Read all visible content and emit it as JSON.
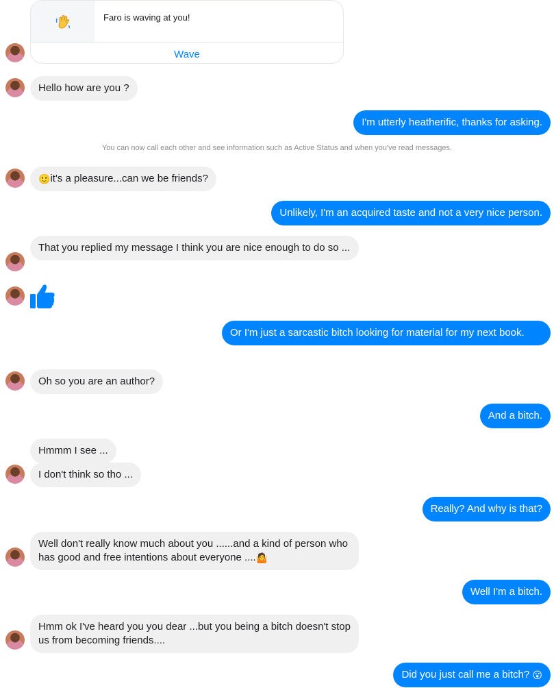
{
  "wave_card": {
    "text": "Faro is waving at you!",
    "button": "Wave",
    "icon": "waving-hand-icon"
  },
  "system_notice": "You can now call each other and see information such as Active Status and when you've read messages.",
  "messages": {
    "m1": "Hello how are you ?",
    "m2": "I'm utterly heatherific, thanks for asking.",
    "m3": "it's a pleasure...can we be friends?",
    "m4": "Unlikely, I'm an acquired taste and not a very nice person.",
    "m5": "That you replied my message I think you are nice enough to do so ...",
    "m6": "Or I'm just a sarcastic bitch looking for material for my next book.",
    "m7": "Oh so you are an author?",
    "m8": "And a bitch.",
    "m9": "Hmmm I see ...",
    "m10": "I don't think so tho ...",
    "m11": "Really? And why is that?",
    "m12": "Well don't really know much about you ......and a kind of person who has good and free intentions about everyone ....",
    "m13": "Well I'm a bitch.",
    "m14": "Hmm ok I've heard you you dear ...but you being a bitch doesn't stop us from becoming friends....",
    "m15": "Did you just call me a bitch?"
  },
  "emojis": {
    "smile": "🙂",
    "shrug": "🤷",
    "surprised": "😮"
  },
  "colors": {
    "outgoing": "#0084ff",
    "incoming": "#f0f0f0",
    "like": "#0084ff"
  }
}
